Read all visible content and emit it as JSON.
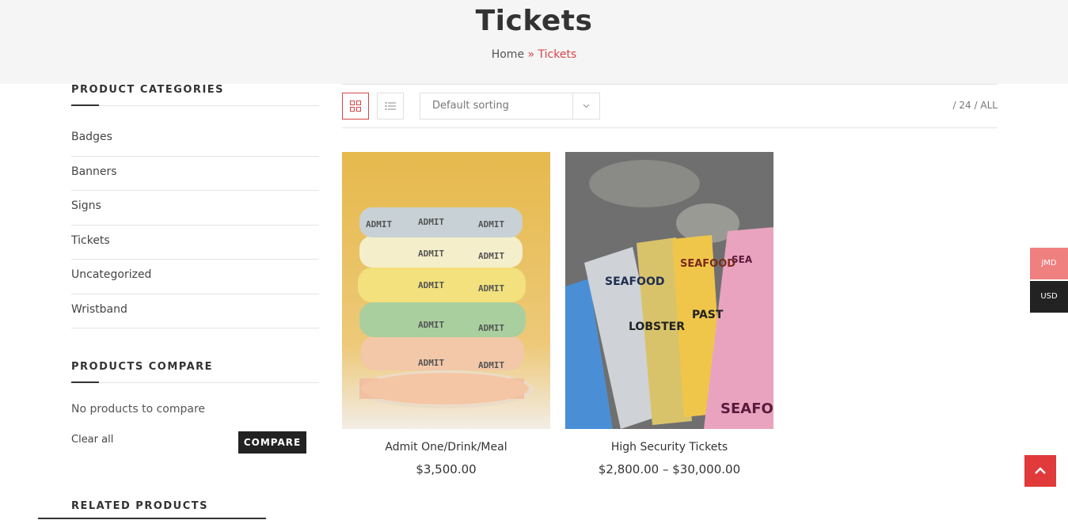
{
  "header": {
    "title": "Tickets",
    "breadcrumb": {
      "home": "Home",
      "separator": "»",
      "current": "Tickets"
    }
  },
  "sidebar": {
    "categories_title": "PRODUCT CATEGORIES",
    "categories": [
      "Badges",
      "Banners",
      "Signs",
      "Tickets",
      "Uncategorized",
      "Wristband"
    ],
    "compare_title": "PRODUCTS COMPARE",
    "no_compare_text": "No products to compare",
    "clear_all": "Clear all",
    "compare_button": "COMPARE",
    "related_title": "RELATED PRODUCTS"
  },
  "toolbar": {
    "sort_label": "Default sorting",
    "per_page_sep1": "/",
    "per_page_24": "24",
    "per_page_sep2": "/",
    "per_page_all": "ALL"
  },
  "products": [
    {
      "name": "Admit One/Drink/Meal",
      "price": "$3,500.00"
    },
    {
      "name": "High Security Tickets",
      "price": "$2,800.00 – $30,000.00"
    }
  ],
  "currency": {
    "jmd": "JMD",
    "usd": "USD"
  },
  "colors": {
    "accent": "#d94446",
    "jmd_bg": "#f07f7f",
    "dark": "#222222",
    "scroll_top": "#e03a3a"
  },
  "icons": [
    "grid-view-icon",
    "list-view-icon",
    "chevron-down-icon",
    "chevron-up-icon"
  ]
}
